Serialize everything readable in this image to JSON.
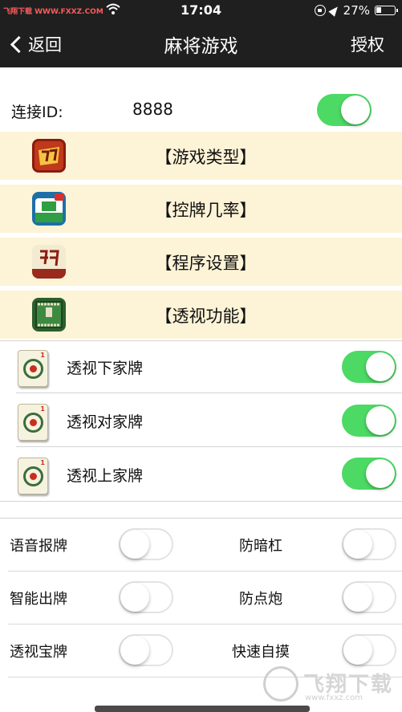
{
  "status_bar": {
    "carrier": "飞翔下载 WWW.FXXZ.COM",
    "time": "17:04",
    "battery": "27%"
  },
  "nav": {
    "back_label": "返回",
    "title": "麻将游戏",
    "right_label": "授权"
  },
  "connect": {
    "label": "连接ID:",
    "value": "8888",
    "enabled": true
  },
  "menu_items": [
    {
      "label": "【游戏类型】",
      "icon": "mahjong-game-icon"
    },
    {
      "label": "【控牌几率】",
      "icon": "mahjong-hd-icon"
    },
    {
      "label": "【程序设置】",
      "icon": "hu-tile-icon"
    },
    {
      "label": "【透视功能】",
      "icon": "mahjong-table-icon"
    }
  ],
  "see_through": [
    {
      "label": "透视下家牌",
      "enabled": true
    },
    {
      "label": "透视对家牌",
      "enabled": true
    },
    {
      "label": "透视上家牌",
      "enabled": true
    }
  ],
  "options": [
    {
      "left": {
        "label": "语音报牌",
        "enabled": false
      },
      "right": {
        "label": "防暗杠",
        "enabled": false
      }
    },
    {
      "left": {
        "label": "智能出牌",
        "enabled": false
      },
      "right": {
        "label": "防点炮",
        "enabled": false
      }
    },
    {
      "left": {
        "label": "透视宝牌",
        "enabled": false
      },
      "right": {
        "label": "快速自摸",
        "enabled": false
      }
    }
  ],
  "tile_mark": "1",
  "watermark": {
    "text": "飞翔下载",
    "url": "www.fxxz.com"
  },
  "colors": {
    "toggle_on": "#4cd964",
    "menu_bg": "#fdf3d6",
    "bar_bg": "#1f1f1f"
  }
}
